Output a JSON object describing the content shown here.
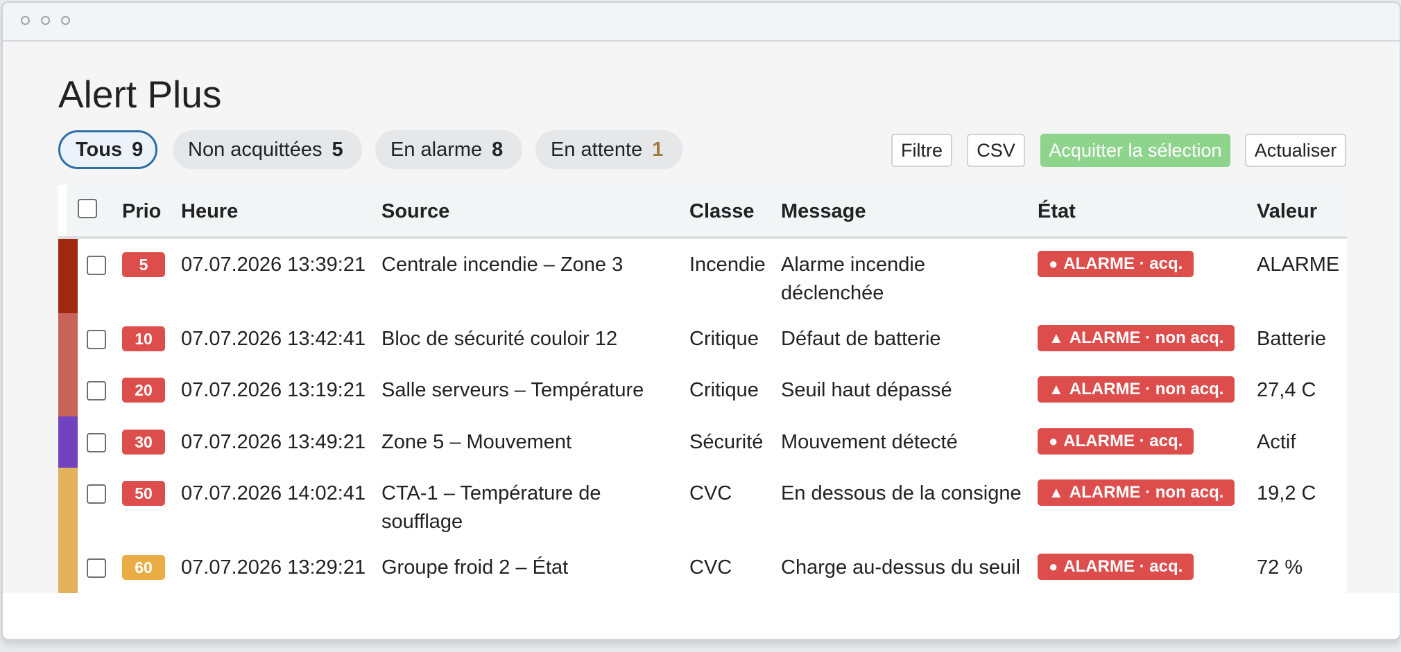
{
  "app": {
    "title": "Alert Plus"
  },
  "filters": [
    {
      "label": "Tous",
      "count": "9",
      "count_color": "#222222",
      "active": true
    },
    {
      "label": "Non acquittées",
      "count": "5",
      "count_color": "#222222",
      "active": false
    },
    {
      "label": "En alarme",
      "count": "8",
      "count_color": "#222222",
      "active": false
    },
    {
      "label": "En attente",
      "count": "1",
      "count_color": "#a0793a",
      "active": false
    }
  ],
  "toolbar": {
    "filter_label": "Filtre",
    "csv_label": "CSV",
    "ack_label": "Acquitter la sélection",
    "refresh_label": "Actualiser"
  },
  "table": {
    "columns": {
      "prio": "Prio",
      "time": "Heure",
      "source": "Source",
      "class": "Classe",
      "message": "Message",
      "state": "État",
      "value": "Valeur"
    },
    "rows": [
      {
        "bar_color": "#a0280f",
        "prio": "5",
        "prio_color": "#dc4d4b",
        "time": "07.07.2026 13:39:21",
        "source": "Centrale incendie – Zone 3",
        "class": "Incendie",
        "message": "Alarme incendie déclenchée",
        "state": "ALARME · acq.",
        "state_icon": "dot-icon",
        "value": "ALARME"
      },
      {
        "bar_color": "#c8635a",
        "prio": "10",
        "prio_color": "#dc4d4b",
        "time": "07.07.2026 13:42:41",
        "source": "Bloc de sécurité couloir 12",
        "class": "Critique",
        "message": "Défaut de batterie",
        "state": "ALARME · non acq.",
        "state_icon": "warning-icon",
        "value": "Batterie"
      },
      {
        "bar_color": "#c8635a",
        "prio": "20",
        "prio_color": "#dc4d4b",
        "time": "07.07.2026 13:19:21",
        "source": "Salle serveurs – Température",
        "class": "Critique",
        "message": "Seuil haut dépassé",
        "state": "ALARME · non acq.",
        "state_icon": "warning-icon",
        "value": "27,4 C"
      },
      {
        "bar_color": "#7243bf",
        "prio": "30",
        "prio_color": "#dc4d4b",
        "time": "07.07.2026 13:49:21",
        "source": "Zone 5 – Mouvement",
        "class": "Sécurité",
        "message": "Mouvement détecté",
        "state": "ALARME · acq.",
        "state_icon": "dot-icon",
        "value": "Actif"
      },
      {
        "bar_color": "#e3b05b",
        "prio": "50",
        "prio_color": "#dc4d4b",
        "time": "07.07.2026 14:02:41",
        "source": "CTA-1 – Température de soufflage",
        "class": "CVC",
        "message": "En dessous de la consigne",
        "state": "ALARME · non acq.",
        "state_icon": "warning-icon",
        "value": "19,2 C"
      },
      {
        "bar_color": "#e3b05b",
        "prio": "60",
        "prio_color": "#eaac45",
        "time": "07.07.2026 13:29:21",
        "source": "Groupe froid 2 – État",
        "class": "CVC",
        "message": "Charge au-dessus du seuil",
        "state": "ALARME · acq.",
        "state_icon": "dot-icon",
        "value": "72 %"
      }
    ]
  }
}
